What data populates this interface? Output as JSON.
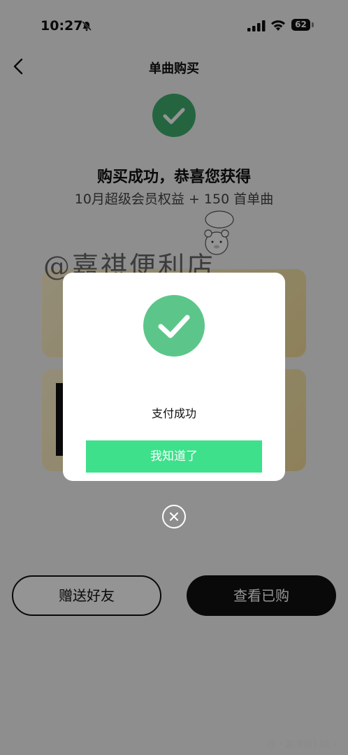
{
  "status_bar": {
    "time": "10:27",
    "battery": "62"
  },
  "nav": {
    "title": "单曲购买"
  },
  "result": {
    "headline": "购买成功，恭喜您获得",
    "subline": "10月超级会员权益 + 150 首单曲"
  },
  "actions": {
    "gift_label": "赠送好友",
    "view_label": "查看已购"
  },
  "watermark": {
    "text": "@嘉祺便利店"
  },
  "modal": {
    "message": "支付成功",
    "confirm_label": "我知道了"
  },
  "footer": {
    "text": "@・嘉祺便利店・"
  },
  "colors": {
    "success_green": "#3fae6e",
    "button_green": "#3ee08b",
    "dark": "#111111"
  }
}
